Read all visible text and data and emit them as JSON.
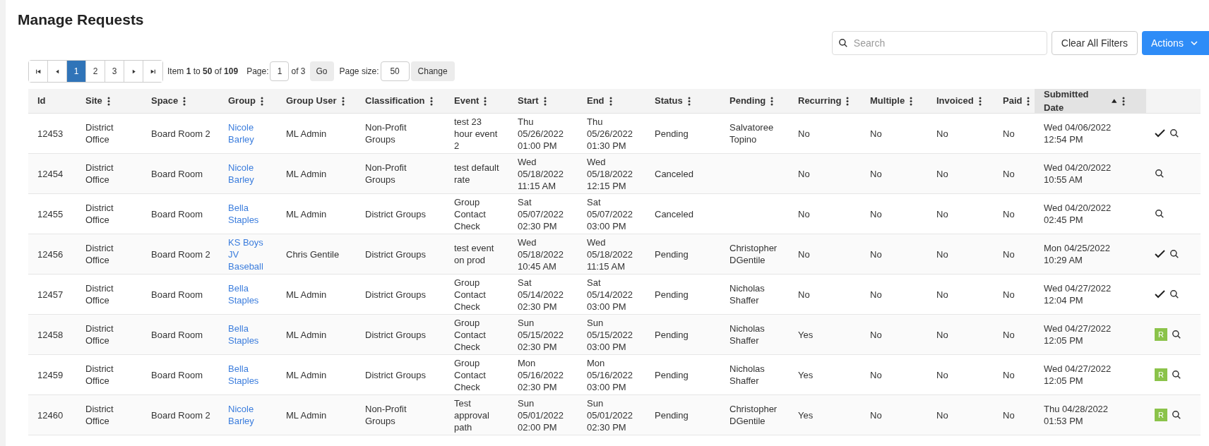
{
  "title": "Manage Requests",
  "search": {
    "placeholder": "Search"
  },
  "clear_button": "Clear All Filters",
  "actions_button": "Actions",
  "pager": {
    "pages": [
      {
        "label": "1",
        "selected": true
      },
      {
        "label": "2",
        "selected": false
      },
      {
        "label": "3",
        "selected": false
      }
    ],
    "summary": "Item **1** to **50** of **109**",
    "page_label": "Page:",
    "page_value": "1",
    "page_of": "of 3",
    "go": "Go",
    "size_label": "Page size:",
    "size_value": "50",
    "change": "Change"
  },
  "table": {
    "columns": [
      {
        "label": "Id",
        "kind": "text",
        "menu": false,
        "sorted": false
      },
      {
        "label": "Site",
        "kind": "text",
        "menu": true,
        "sorted": false
      },
      {
        "label": "Space",
        "kind": "text",
        "menu": true,
        "sorted": false
      },
      {
        "label": "Group",
        "kind": "link",
        "menu": true,
        "sorted": false
      },
      {
        "label": "Group User",
        "kind": "text",
        "menu": true,
        "sorted": false
      },
      {
        "label": "Classification",
        "kind": "text",
        "menu": true,
        "sorted": false
      },
      {
        "label": "Event",
        "kind": "text",
        "menu": true,
        "sorted": false
      },
      {
        "label": "Start",
        "kind": "text",
        "menu": true,
        "sorted": false
      },
      {
        "label": "End",
        "kind": "text",
        "menu": true,
        "sorted": false
      },
      {
        "label": "Status",
        "kind": "text",
        "menu": true,
        "sorted": false
      },
      {
        "label": "Pending",
        "kind": "text",
        "menu": true,
        "sorted": false
      },
      {
        "label": "Recurring",
        "kind": "text",
        "menu": true,
        "sorted": false
      },
      {
        "label": "Multiple",
        "kind": "text",
        "menu": true,
        "sorted": false
      },
      {
        "label": "Invoiced",
        "kind": "text",
        "menu": true,
        "sorted": false
      },
      {
        "label": "Paid",
        "kind": "text",
        "menu": true,
        "sorted": false
      },
      {
        "label": "Submitted Date",
        "kind": "text",
        "menu": true,
        "sorted": true
      }
    ],
    "rows": [
      {
        "cells": [
          "12453",
          "District Office",
          "Board Room 2",
          "Nicole Barley",
          "ML Admin",
          "Non-Profit Groups",
          "test 23 hour event 2",
          "Thu 05/26/2022 01:00 PM",
          "Thu 05/26/2022 01:30 PM",
          "Pending",
          "Salvatoree Topino",
          "No",
          "No",
          "No",
          "No",
          "Wed 04/06/2022 12:54 PM"
        ],
        "actions": [
          {
            "kind": "check"
          },
          {
            "kind": "search"
          }
        ]
      },
      {
        "cells": [
          "12454",
          "District Office",
          "Board Room",
          "Nicole Barley",
          "ML Admin",
          "Non-Profit Groups",
          "test default rate",
          "Wed 05/18/2022 11:15 AM",
          "Wed 05/18/2022 12:15 PM",
          "Canceled",
          "",
          "No",
          "No",
          "No",
          "No",
          "Wed 04/20/2022 10:55 AM"
        ],
        "actions": [
          {
            "kind": "search"
          }
        ]
      },
      {
        "cells": [
          "12455",
          "District Office",
          "Board Room",
          "Bella Staples",
          "ML Admin",
          "District Groups",
          "Group Contact Check",
          "Sat 05/07/2022 02:30 PM",
          "Sat 05/07/2022 03:00 PM",
          "Canceled",
          "",
          "No",
          "No",
          "No",
          "No",
          "Wed 04/20/2022 02:45 PM"
        ],
        "actions": [
          {
            "kind": "search"
          }
        ]
      },
      {
        "cells": [
          "12456",
          "District Office",
          "Board Room 2",
          "KS Boys JV Baseball",
          "Chris Gentile",
          "District Groups",
          "test event on prod",
          "Wed 05/18/2022 10:45 AM",
          "Wed 05/18/2022 11:15 AM",
          "Pending",
          "Christopher DGentile",
          "No",
          "No",
          "No",
          "No",
          "Mon 04/25/2022 10:29 AM"
        ],
        "actions": [
          {
            "kind": "check"
          },
          {
            "kind": "search"
          }
        ]
      },
      {
        "cells": [
          "12457",
          "District Office",
          "Board Room",
          "Bella Staples",
          "ML Admin",
          "District Groups",
          "Group Contact Check",
          "Sat 05/14/2022 02:30 PM",
          "Sat 05/14/2022 03:00 PM",
          "Pending",
          "Nicholas Shaffer",
          "No",
          "No",
          "No",
          "No",
          "Wed 04/27/2022 12:04 PM"
        ],
        "actions": [
          {
            "kind": "check"
          },
          {
            "kind": "search"
          }
        ]
      },
      {
        "cells": [
          "12458",
          "District Office",
          "Board Room",
          "Bella Staples",
          "ML Admin",
          "District Groups",
          "Group Contact Check",
          "Sun 05/15/2022 02:30 PM",
          "Sun 05/15/2022 03:00 PM",
          "Pending",
          "Nicholas Shaffer",
          "Yes",
          "No",
          "No",
          "No",
          "Wed 04/27/2022 12:05 PM"
        ],
        "actions": [
          {
            "kind": "badge",
            "label": "R"
          },
          {
            "kind": "search"
          }
        ]
      },
      {
        "cells": [
          "12459",
          "District Office",
          "Board Room",
          "Bella Staples",
          "ML Admin",
          "District Groups",
          "Group Contact Check",
          "Mon 05/16/2022 02:30 PM",
          "Mon 05/16/2022 03:00 PM",
          "Pending",
          "Nicholas Shaffer",
          "Yes",
          "No",
          "No",
          "No",
          "Wed 04/27/2022 12:05 PM"
        ],
        "actions": [
          {
            "kind": "badge",
            "label": "R"
          },
          {
            "kind": "search"
          }
        ]
      },
      {
        "cells": [
          "12460",
          "District Office",
          "Board Room 2",
          "Nicole Barley",
          "ML Admin",
          "Non-Profit Groups",
          "Test approval path",
          "Sun 05/01/2022 02:00 PM",
          "Sun 05/01/2022 02:30 PM",
          "Pending",
          "Christopher DGentile",
          "Yes",
          "No",
          "No",
          "No",
          "Thu 04/28/2022 01:53 PM"
        ],
        "actions": [
          {
            "kind": "badge",
            "label": "R"
          },
          {
            "kind": "search"
          }
        ]
      }
    ]
  }
}
